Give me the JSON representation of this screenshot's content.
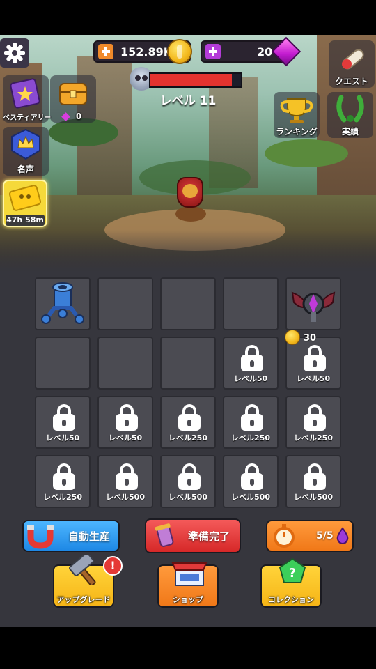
{
  "currency": {
    "gold": "152.89K",
    "gems": "20",
    "gold_plus_color": "#f08a2a",
    "gem_plus_color": "#b43cd8"
  },
  "left_menu": {
    "bestiary_label": "ベスティアリー",
    "chest_gems": "0",
    "fame_label": "名声",
    "ticket_timer": "47h 58m"
  },
  "right_menu": {
    "quest_label": "クエスト",
    "ranking_label": "ランキング",
    "achievements_label": "実績"
  },
  "enemy": {
    "level_label": "レベル 11",
    "hp_fraction": 0.9
  },
  "grid": {
    "cells": [
      {
        "state": "turret"
      },
      {
        "state": "empty"
      },
      {
        "state": "empty"
      },
      {
        "state": "empty"
      },
      {
        "state": "emblem"
      },
      {
        "state": "empty"
      },
      {
        "state": "empty"
      },
      {
        "state": "empty"
      },
      {
        "state": "locked",
        "label": "レベル50"
      },
      {
        "state": "locked",
        "label": "レベル50"
      },
      {
        "state": "locked",
        "label": "レベル50"
      },
      {
        "state": "locked",
        "label": "レベル50"
      },
      {
        "state": "locked",
        "label": "レベル250"
      },
      {
        "state": "locked",
        "label": "レベル250"
      },
      {
        "state": "locked",
        "label": "レベル250"
      },
      {
        "state": "locked",
        "label": "レベル250"
      },
      {
        "state": "locked",
        "label": "レベル500"
      },
      {
        "state": "locked",
        "label": "レベル500"
      },
      {
        "state": "locked",
        "label": "レベル500"
      },
      {
        "state": "locked",
        "label": "レベル500"
      }
    ],
    "unlock_cost": "30"
  },
  "actions": {
    "auto_produce_label": "自動生産",
    "ready_label": "準備完了",
    "energy_count": "5/5"
  },
  "bottom_nav": {
    "upgrade_label": "アップグレード",
    "upgrade_badge": "!",
    "shop_label": "ショップ",
    "collection_label": "コレクション"
  }
}
